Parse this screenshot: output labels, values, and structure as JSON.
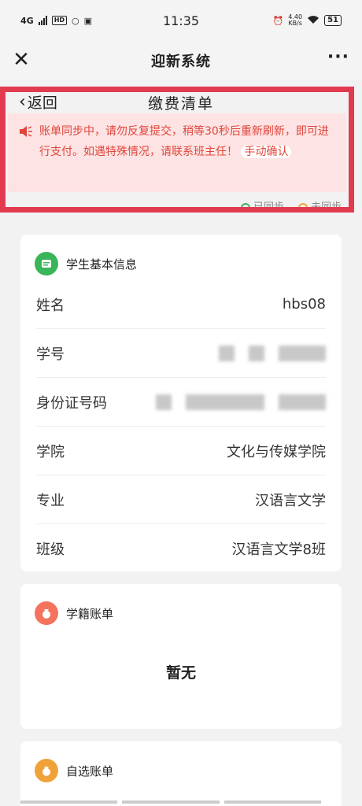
{
  "status_bar": {
    "network": "4G",
    "hd": "HD",
    "time": "11:35",
    "speed_value": "4.40",
    "speed_unit": "KB/s",
    "battery": "51"
  },
  "nav": {
    "title": "迎新系统"
  },
  "page": {
    "back_label": "返回",
    "title": "缴费清单"
  },
  "notice": {
    "text": "账单同步中，请勿反复提交，稍等30秒后重新刷新，即可进行支付。如遇特殊情况，请联系班主任！",
    "confirm_label": "手动确认"
  },
  "sync_legend": {
    "synced": "已同步",
    "unsynced": "未同步"
  },
  "student_info": {
    "title": "学生基本信息",
    "rows": [
      {
        "label": "姓名",
        "value": "hbs08"
      },
      {
        "label": "学号",
        "value": ""
      },
      {
        "label": "身份证号码",
        "value": ""
      },
      {
        "label": "学院",
        "value": "文化与传媒学院"
      },
      {
        "label": "专业",
        "value": "汉语言文学"
      },
      {
        "label": "班级",
        "value": "汉语言文学8班"
      }
    ]
  },
  "enrollment_bill": {
    "title": "学籍账单",
    "empty": "暂无"
  },
  "optional_bill": {
    "title": "自选账单"
  },
  "colors": {
    "accent_red": "#e23b50",
    "notice_text": "#e0453b",
    "green": "#39b55a",
    "orange": "#f0a23a",
    "coral": "#f3735e"
  }
}
